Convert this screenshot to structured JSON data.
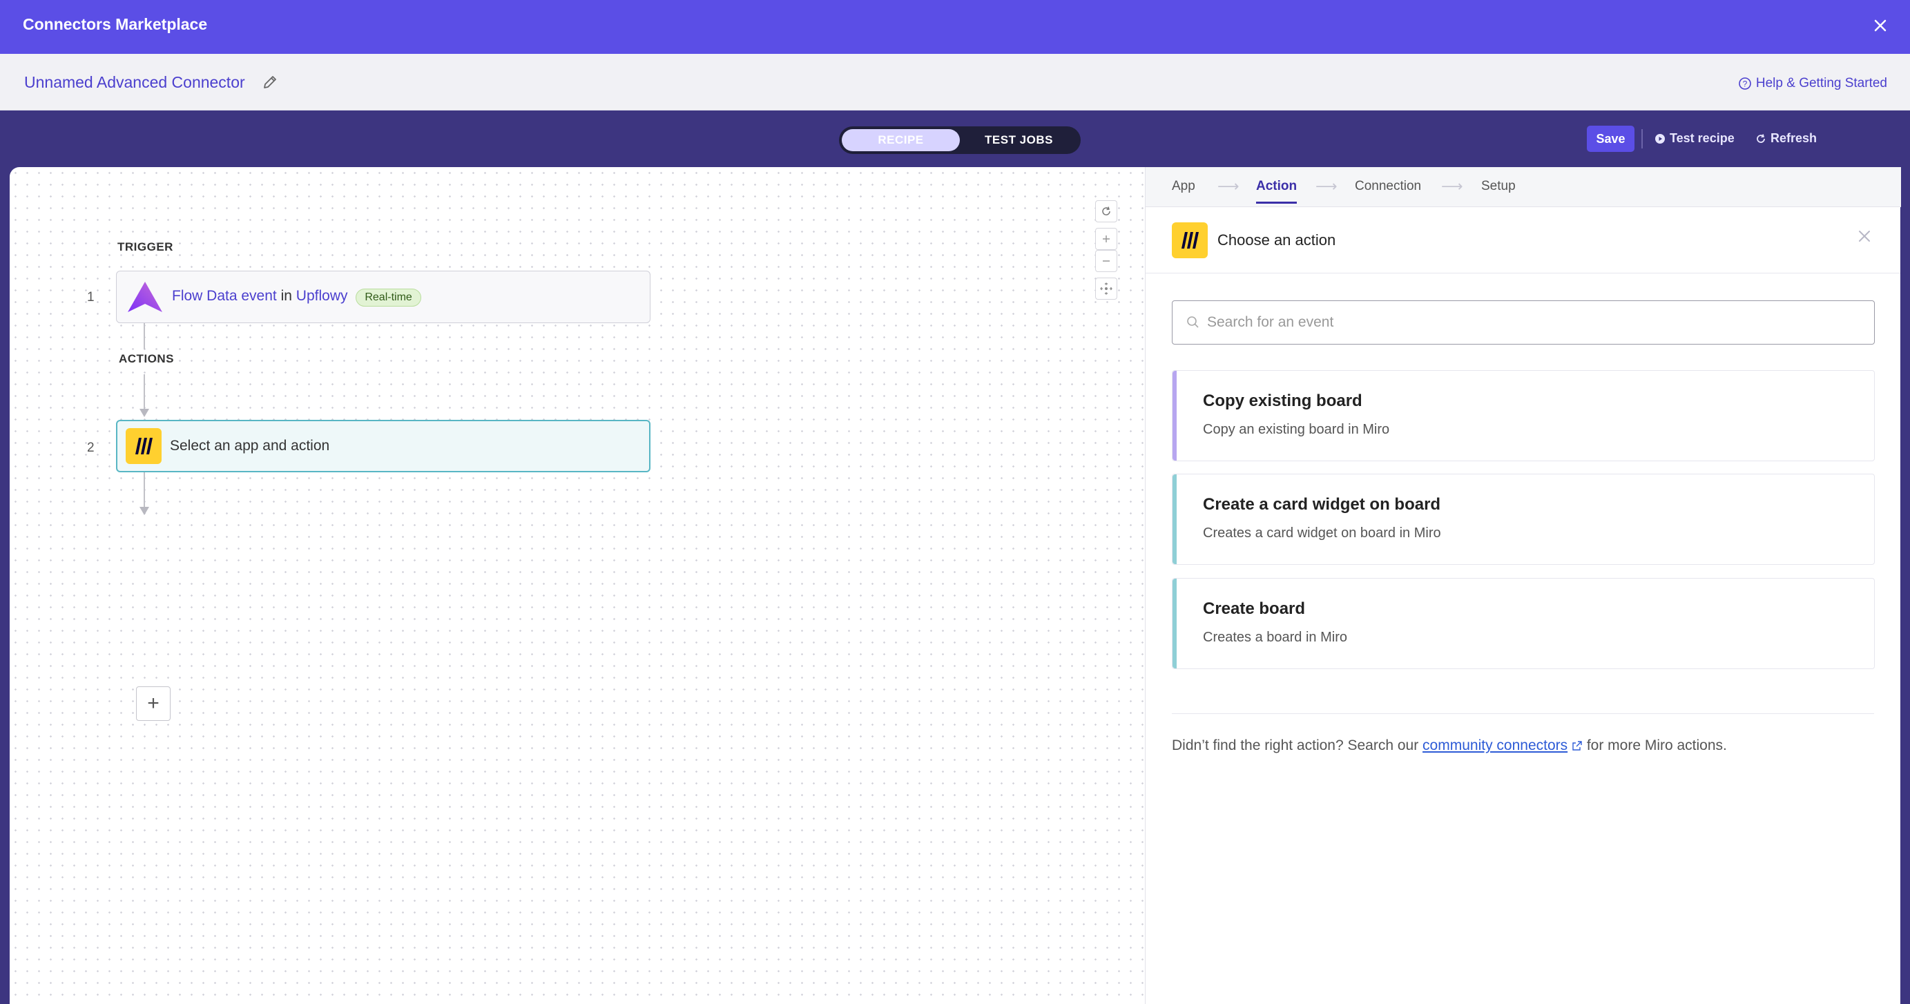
{
  "header": {
    "title": "Connectors Marketplace",
    "close_icon": "close-icon"
  },
  "subheader": {
    "connector_name": "Unnamed Advanced Connector",
    "help_label": "Help & Getting Started"
  },
  "toolbar": {
    "tabs": [
      {
        "label": "RECIPE",
        "active": true
      },
      {
        "label": "TEST JOBS",
        "active": false
      }
    ],
    "save_label": "Save",
    "test_recipe_label": "Test recipe",
    "refresh_label": "Refresh"
  },
  "canvas": {
    "trigger_label": "TRIGGER",
    "actions_label": "ACTIONS",
    "steps": [
      {
        "number": "1",
        "event": "Flow Data event",
        "connector_word": "in",
        "app": "Upflowy",
        "badge": "Real-time"
      },
      {
        "number": "2",
        "text": "Select an app and action"
      }
    ],
    "add_symbol": "+"
  },
  "panel": {
    "nav": [
      "App",
      "Action",
      "Connection",
      "Setup"
    ],
    "active_nav": "Action",
    "choose_title": "Choose an action",
    "search_placeholder": "Search for an event",
    "actions": [
      {
        "title": "Copy existing board",
        "desc": "Copy an existing board in Miro",
        "color": "#b7a6f0"
      },
      {
        "title": "Create a card widget on board",
        "desc": "Creates a card widget on board in Miro",
        "color": "#8fcfd6"
      },
      {
        "title": "Create board",
        "desc": "Creates a board in Miro",
        "color": "#8fcfd6"
      }
    ],
    "footnote": {
      "before": "Didn’t find the right action? Search our ",
      "link": "community connectors",
      "after": " for more Miro actions."
    }
  },
  "colors": {
    "brand": "#5b4ee6",
    "dark": "#3d3580",
    "accent_teal": "#58b6c4"
  }
}
